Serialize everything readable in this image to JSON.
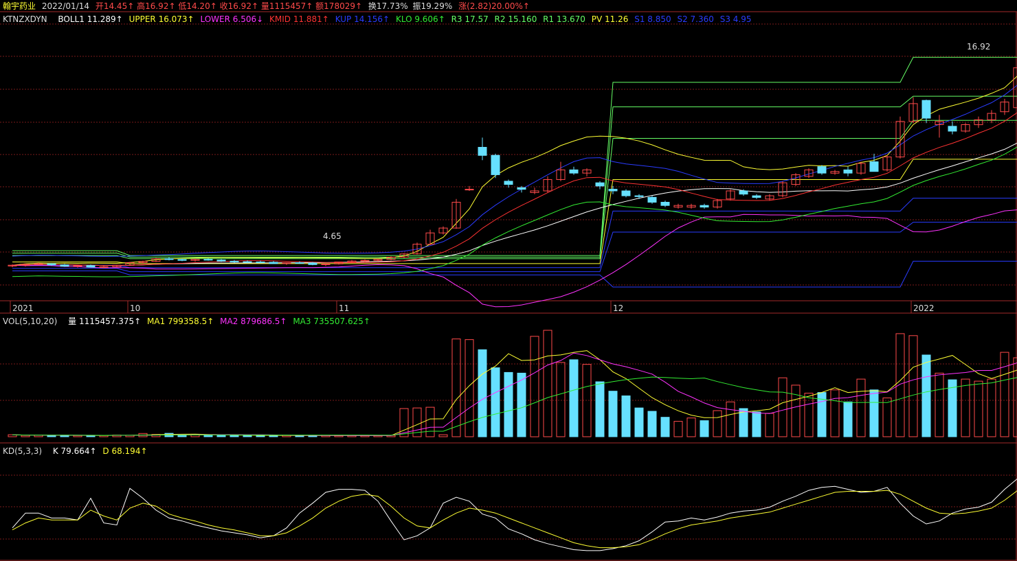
{
  "colors": {
    "bg": "#000000",
    "grid": "#7a1a1a",
    "up": "#ff4a4a",
    "down": "#66e0ff",
    "white": "#ffffff",
    "yellow": "#ffff33",
    "magenta": "#ff33ff",
    "red": "#ff3333",
    "blue": "#2a3cff",
    "green": "#33ee33",
    "lime": "#66ff66"
  },
  "header": {
    "stock_name": "翰宇药业",
    "date": "2022/01/14",
    "open": "开14.45↑",
    "high": "高16.92↑",
    "low": "低14.20↑",
    "close": "收16.92↑",
    "volume": "量1115457↑",
    "amount": "额178029↑",
    "turnover": "换17.73%",
    "amplitude": "振19.29%",
    "change": "涨(2.82)20.00%↑"
  },
  "indicator_line": {
    "ktn": "KTNZXDYN",
    "boll": "BOLL1 11.289↑",
    "upper": "UPPER 16.073↑",
    "lower": "LOWER 6.506↓",
    "kmid": "KMID 11.881↑",
    "kup": "KUP 14.156↑",
    "klo": "KLO 9.606↑",
    "r3": "R3 17.57",
    "r2": "R2 15.160",
    "r1": "R1 13.670",
    "pv": "PV 11.26",
    "s1": "S1 8.850",
    "s2": "S2 7.360",
    "s3": "S3 4.95"
  },
  "vol_header": {
    "label": "VOL(5,10,20)",
    "vol": "量 1115457.375↑",
    "ma1": "MA1 799358.5↑",
    "ma2": "MA2 879686.5↑",
    "ma3": "MA3 735507.625↑"
  },
  "kd_header": {
    "label": "KD(5,3,3)",
    "k": "K 79.664↑",
    "d": "D 68.194↑"
  },
  "annotations": {
    "max_price": "16.92",
    "min_price": "4.65"
  },
  "chart_data": {
    "type": "candlestick",
    "x_labels": [
      {
        "i": 0,
        "text": "2021"
      },
      {
        "i": 9,
        "text": "10"
      },
      {
        "i": 25,
        "text": "11"
      },
      {
        "i": 46,
        "text": "12"
      },
      {
        "i": 69,
        "text": "2022"
      }
    ],
    "price_range": [
      2.5,
      19.5
    ],
    "candles": [
      [
        4.65,
        4.75,
        4.58,
        4.7
      ],
      [
        4.7,
        4.8,
        4.62,
        4.76
      ],
      [
        4.76,
        4.85,
        4.7,
        4.79
      ],
      [
        4.79,
        4.83,
        4.66,
        4.72
      ],
      [
        4.72,
        4.78,
        4.6,
        4.64
      ],
      [
        4.64,
        4.7,
        4.55,
        4.68
      ],
      [
        4.68,
        4.74,
        4.56,
        4.58
      ],
      [
        4.58,
        4.66,
        4.52,
        4.6
      ],
      [
        4.6,
        4.72,
        4.58,
        4.7
      ],
      [
        4.7,
        4.9,
        4.66,
        4.86
      ],
      [
        4.86,
        4.98,
        4.78,
        4.94
      ],
      [
        4.94,
        5.15,
        4.9,
        5.1
      ],
      [
        5.1,
        5.2,
        5.0,
        5.05
      ],
      [
        5.05,
        5.12,
        4.95,
        5.0
      ],
      [
        5.0,
        5.1,
        4.92,
        5.06
      ],
      [
        5.06,
        5.14,
        4.98,
        5.02
      ],
      [
        5.02,
        5.08,
        4.9,
        4.95
      ],
      [
        4.95,
        5.02,
        4.86,
        4.92
      ],
      [
        4.92,
        5.0,
        4.84,
        4.9
      ],
      [
        4.9,
        4.98,
        4.82,
        4.88
      ],
      [
        4.88,
        4.96,
        4.78,
        4.8
      ],
      [
        4.8,
        4.88,
        4.72,
        4.86
      ],
      [
        4.86,
        4.94,
        4.78,
        4.84
      ],
      [
        4.84,
        4.9,
        4.7,
        4.74
      ],
      [
        4.74,
        4.8,
        4.65,
        4.78
      ],
      [
        4.78,
        4.92,
        4.74,
        4.9
      ],
      [
        4.9,
        5.02,
        4.84,
        4.96
      ],
      [
        4.96,
        5.06,
        4.9,
        5.0
      ],
      [
        5.0,
        5.1,
        4.94,
        5.06
      ],
      [
        5.06,
        5.25,
        5.0,
        5.2
      ],
      [
        5.2,
        5.45,
        5.14,
        5.4
      ],
      [
        5.4,
        6.1,
        5.36,
        6.0
      ],
      [
        6.0,
        6.9,
        5.94,
        6.7
      ],
      [
        6.7,
        7.1,
        6.6,
        7.0
      ],
      [
        7.0,
        8.8,
        6.95,
        8.6
      ],
      [
        9.4,
        9.6,
        9.3,
        9.4
      ],
      [
        12.0,
        12.6,
        11.2,
        11.5
      ],
      [
        11.5,
        11.6,
        10.1,
        10.3
      ],
      [
        9.9,
        10.0,
        9.5,
        9.7
      ],
      [
        9.5,
        9.6,
        9.2,
        9.4
      ],
      [
        9.2,
        9.5,
        9.1,
        9.3
      ],
      [
        9.3,
        10.2,
        9.2,
        10.0
      ],
      [
        10.0,
        11.1,
        9.9,
        10.6
      ],
      [
        10.6,
        10.8,
        10.3,
        10.4
      ],
      [
        10.4,
        10.7,
        10.2,
        10.6
      ],
      [
        9.8,
        9.9,
        9.4,
        9.6
      ],
      [
        9.4,
        9.6,
        9.1,
        9.3
      ],
      [
        9.3,
        9.4,
        8.9,
        9.0
      ],
      [
        9.0,
        9.1,
        8.8,
        8.95
      ],
      [
        8.9,
        9.0,
        8.5,
        8.6
      ],
      [
        8.6,
        8.7,
        8.3,
        8.4
      ],
      [
        8.3,
        8.5,
        8.2,
        8.4
      ],
      [
        8.3,
        8.5,
        8.2,
        8.4
      ],
      [
        8.4,
        8.5,
        8.2,
        8.3
      ],
      [
        8.3,
        8.8,
        8.2,
        8.7
      ],
      [
        8.8,
        9.4,
        8.7,
        9.3
      ],
      [
        9.3,
        9.4,
        9.0,
        9.1
      ],
      [
        9.0,
        9.1,
        8.8,
        8.9
      ],
      [
        8.8,
        9.1,
        8.7,
        9.0
      ],
      [
        9.0,
        9.9,
        8.9,
        9.8
      ],
      [
        9.7,
        10.4,
        9.6,
        10.3
      ],
      [
        10.2,
        10.7,
        10.1,
        10.6
      ],
      [
        10.8,
        10.9,
        10.3,
        10.4
      ],
      [
        10.4,
        10.6,
        10.3,
        10.5
      ],
      [
        10.6,
        10.8,
        10.2,
        10.4
      ],
      [
        10.4,
        11.1,
        10.3,
        11.0
      ],
      [
        11.1,
        11.6,
        10.9,
        10.5
      ],
      [
        10.6,
        11.5,
        10.5,
        11.4
      ],
      [
        11.4,
        13.9,
        11.3,
        13.6
      ],
      [
        13.6,
        15.1,
        13.5,
        14.7
      ],
      [
        14.9,
        14.95,
        13.5,
        13.8
      ],
      [
        13.4,
        14.0,
        12.6,
        13.6
      ],
      [
        13.3,
        13.6,
        12.8,
        13.0
      ],
      [
        13.0,
        13.5,
        12.9,
        13.4
      ],
      [
        13.4,
        13.9,
        13.2,
        13.7
      ],
      [
        13.7,
        14.3,
        13.5,
        14.1
      ],
      [
        14.2,
        15.0,
        14.0,
        14.8
      ],
      [
        14.45,
        16.92,
        14.2,
        16.92
      ]
    ],
    "volume": [
      30,
      20,
      25,
      18,
      22,
      18,
      15,
      20,
      25,
      22,
      48,
      35,
      50,
      30,
      28,
      22,
      25,
      20,
      18,
      20,
      18,
      20,
      16,
      18,
      20,
      16,
      18,
      17,
      16,
      20,
      420,
      430,
      440,
      30,
      1460,
      1450,
      1300,
      1030,
      960,
      950,
      1500,
      1590,
      1110,
      1150,
      1080,
      820,
      680,
      610,
      430,
      380,
      290,
      230,
      280,
      240,
      390,
      520,
      420,
      370,
      350,
      880,
      770,
      650,
      660,
      700,
      520,
      860,
      700,
      580,
      1540,
      1510,
      1220,
      950,
      850,
      860,
      830,
      860,
      1260,
      1180
    ],
    "vol_max": 1600,
    "kd_k": [
      30,
      45,
      45,
      40,
      40,
      38,
      60,
      35,
      33,
      70,
      60,
      48,
      40,
      37,
      33,
      30,
      27,
      25,
      23,
      20,
      22,
      30,
      45,
      55,
      66,
      69,
      69,
      68,
      57,
      37,
      18,
      22,
      30,
      55,
      61,
      57,
      44,
      40,
      29,
      24,
      18,
      14,
      11,
      8,
      7,
      7,
      9,
      12,
      17,
      26,
      36,
      37,
      40,
      38,
      41,
      45,
      47,
      48,
      51,
      57,
      62,
      68,
      71,
      72,
      69,
      66,
      67,
      71,
      55,
      42,
      34,
      37,
      45,
      49,
      51,
      56,
      69,
      80
    ],
    "kd_d": [
      28,
      35,
      40,
      38,
      38,
      38,
      48,
      42,
      38,
      50,
      55,
      52,
      44,
      40,
      37,
      33,
      30,
      28,
      25,
      22,
      22,
      25,
      32,
      40,
      50,
      57,
      62,
      64,
      62,
      52,
      40,
      32,
      30,
      38,
      45,
      50,
      48,
      45,
      40,
      35,
      30,
      25,
      20,
      15,
      12,
      10,
      10,
      11,
      13,
      18,
      24,
      29,
      33,
      35,
      37,
      40,
      42,
      44,
      46,
      50,
      54,
      58,
      62,
      66,
      67,
      67,
      67,
      68,
      64,
      57,
      50,
      45,
      44,
      45,
      47,
      50,
      58,
      68
    ]
  }
}
